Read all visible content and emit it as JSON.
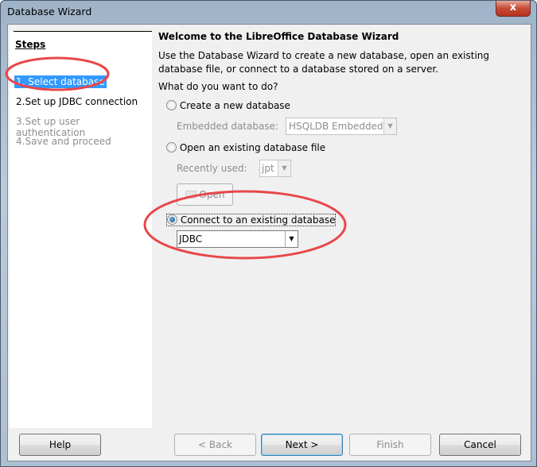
{
  "window": {
    "title": "Database Wizard",
    "close_label": "x"
  },
  "steps": {
    "heading": "Steps",
    "items": [
      {
        "label": "1. Select database",
        "state": "selected"
      },
      {
        "label": "2.Set up JDBC connection",
        "state": "enabled"
      },
      {
        "label": "3.Set up user authentication",
        "state": "disabled"
      },
      {
        "label": "4.Save and proceed",
        "state": "disabled"
      }
    ]
  },
  "main": {
    "heading": "Welcome to the LibreOffice Database Wizard",
    "intro_line1": "Use the Database Wizard to create a new database, open an existing",
    "intro_line2": "database file, or connect to a database stored on a server.",
    "question": "What do you want to do?",
    "create_new": "Create a new database",
    "embedded_label": "Embedded database:",
    "embedded_value": "HSQLDB Embedded",
    "open_existing": "Open an existing database file",
    "recent_label": "Recently used:",
    "recent_value": "jpt",
    "open_button": "Open",
    "connect_existing": "Connect to an existing database",
    "connect_value": "JDBC"
  },
  "buttons": {
    "help": "Help",
    "back": "< Back",
    "next": "Next >",
    "finish": "Finish",
    "cancel": "Cancel"
  },
  "annotation_color": "#e8474a"
}
